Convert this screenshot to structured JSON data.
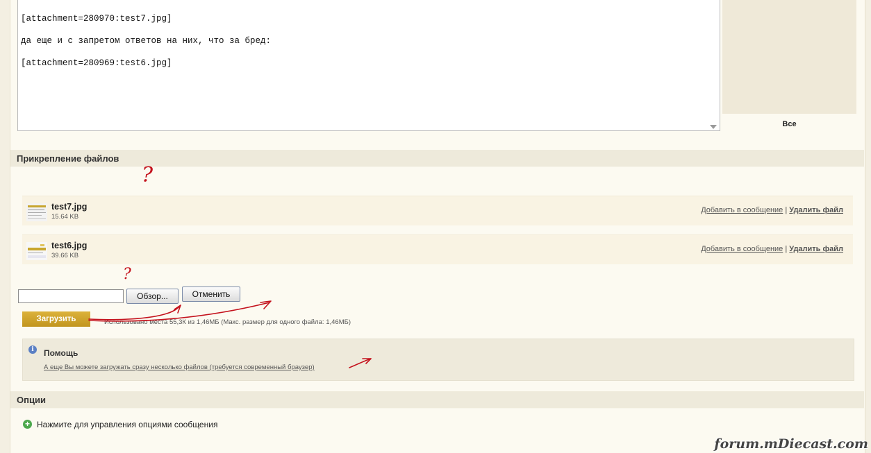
{
  "editor": {
    "lines": [
      "[attachment=280970:test7.jpg]",
      "да еще и с запретом ответов на них, что за бред:",
      "[attachment=280969:test6.jpg]"
    ]
  },
  "smilies": {
    "all_label": "Все"
  },
  "attachments_section": {
    "title": "Прикрепление файлов",
    "files": [
      {
        "name": "test7.jpg",
        "size": "15.64 KB"
      },
      {
        "name": "test6.jpg",
        "size": "39.66 KB"
      }
    ],
    "add_to_post_label": "Добавить в сообщение",
    "separator": "|",
    "delete_label": "Удалить файл"
  },
  "upload": {
    "file_input_value": "",
    "browse_label": "Обзор...",
    "cancel_label": "Отменить",
    "upload_label": "Загрузить",
    "usage_text": "Использовано места 55,3К из 1,46МБ (Макс. размер для одного файла: 1,46МБ)"
  },
  "help": {
    "icon_glyph": "i",
    "title": "Помощь",
    "link_text": "А еще Вы можете загружать сразу несколько файлов (требуется современный браузер)"
  },
  "options_section": {
    "title": "Опции",
    "icon_glyph": "+",
    "toggle_text": "Нажмите для управления опциями сообщения"
  },
  "annotations": {
    "question_mark": "?"
  },
  "watermark": {
    "text": "forum.mDiecast.com"
  },
  "colors": {
    "page_bg": "#fcfaf1",
    "header_bg": "#eeeadb",
    "upload_button": "#c9a12b",
    "red_ink": "#c4121d",
    "info_icon": "#5b80c4",
    "options_icon": "#4da84d"
  }
}
